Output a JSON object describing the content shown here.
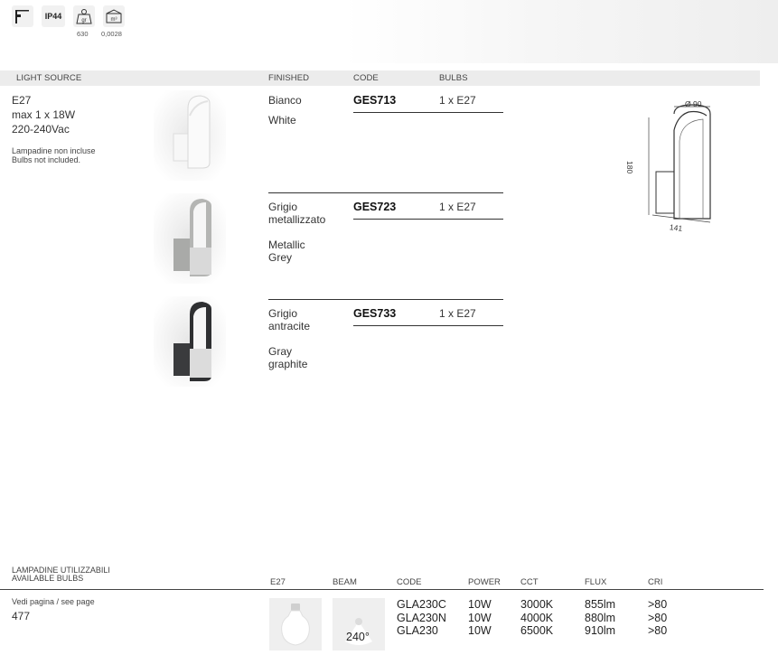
{
  "icons": {
    "wall_icon": "wall-mount-icon",
    "ip_rating": "IP44",
    "weight_icon": "weight-icon",
    "weight_value": "630",
    "volume_icon": "box-volume-icon",
    "volume_value": "0,0028"
  },
  "table_headers": {
    "light_source": "LIGHT SOURCE",
    "finished": "FINISHED",
    "code": "CODE",
    "bulbs": "BULBS"
  },
  "light_source": {
    "socket": "E27",
    "power": "max 1 x 18W",
    "voltage": "220-240Vac",
    "note_it": "Lampadine non incluse",
    "note_en": "Bulbs not included."
  },
  "products": [
    {
      "finish_it": "Bianco",
      "finish_en": "White",
      "code": "GES713",
      "bulbs": "1 x E27",
      "color": "#f4f4f4"
    },
    {
      "finish_it": "Grigio metallizzato",
      "finish_en": "Metallic Grey",
      "code": "GES723",
      "bulbs": "1 x E27",
      "color": "#a9aaa8"
    },
    {
      "finish_it": "Grigio antracite",
      "finish_en": "Gray graphite",
      "code": "GES733",
      "bulbs": "1 x E27",
      "color": "#3a3b3d"
    }
  ],
  "dimensions": {
    "diameter": "Ø 90",
    "height": "180",
    "depth": "141"
  },
  "bulbs_section": {
    "title_it": "LAMPADINE UTILIZZABILI",
    "title_en": "AVAILABLE BULBS",
    "see_page": "Vedi pagina / see page",
    "page_number": "477",
    "headers": {
      "e27": "E27",
      "beam": "BEAM",
      "code": "CODE",
      "power": "POWER",
      "cct": "CCT",
      "flux": "FLUX",
      "cri": "CRI"
    },
    "beam_angle": "240°",
    "rows": [
      {
        "code": "GLA230C",
        "power": "10W",
        "cct": "3000K",
        "flux": "855lm",
        "cri": ">80"
      },
      {
        "code": "GLA230N",
        "power": "10W",
        "cct": "4000K",
        "flux": "880lm",
        "cri": ">80"
      },
      {
        "code": "GLA230",
        "power": "10W",
        "cct": "6500K",
        "flux": "910lm",
        "cri": ">80"
      }
    ]
  }
}
